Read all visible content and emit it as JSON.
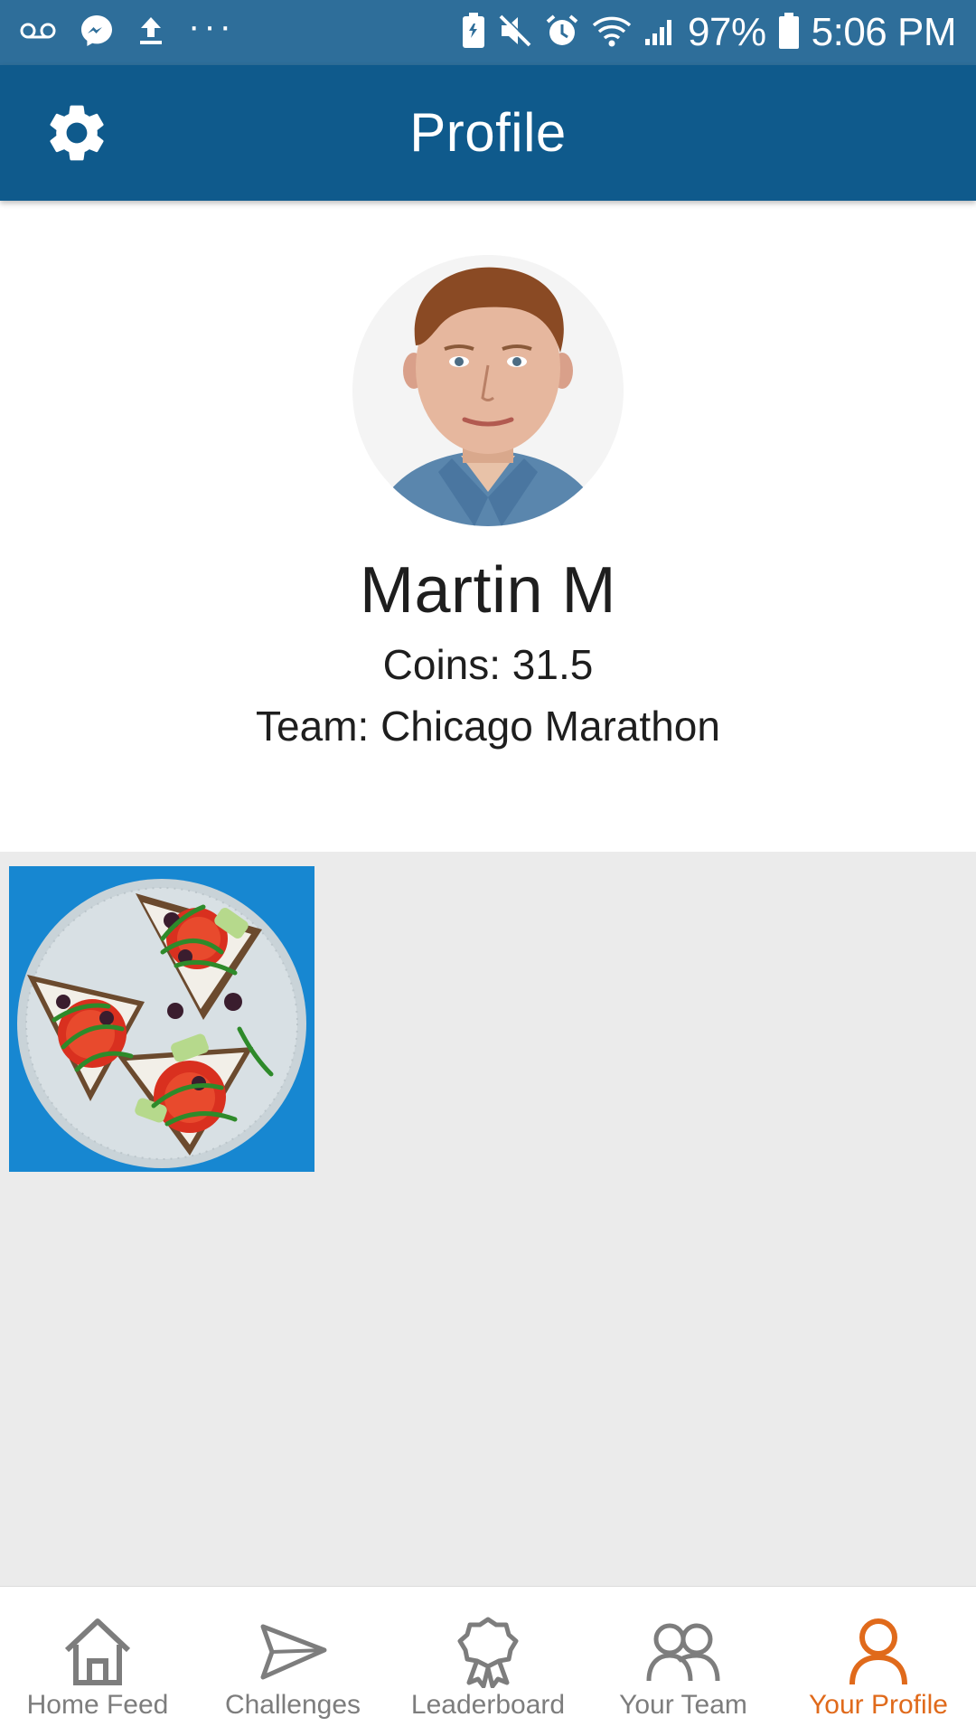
{
  "status_bar": {
    "battery": "97%",
    "time": "5:06 PM"
  },
  "app_bar": {
    "title": "Profile",
    "settings_icon": "gear-icon"
  },
  "profile": {
    "name": "Martin M",
    "coins": "Coins: 31.5",
    "team": "Team: Chicago Marathon"
  },
  "posts": [
    {
      "subject": "food-photo"
    }
  ],
  "bottom_nav": {
    "active": "Your Profile",
    "active_color": "#e06a1b",
    "inactive_color": "#7d7d7d",
    "items": [
      {
        "label": "Home Feed",
        "icon": "home-icon"
      },
      {
        "label": "Challenges",
        "icon": "paper-plane-icon"
      },
      {
        "label": "Leaderboard",
        "icon": "ribbon-icon"
      },
      {
        "label": "Your Team",
        "icon": "team-icon"
      },
      {
        "label": "Your Profile",
        "icon": "person-icon"
      }
    ]
  },
  "colors": {
    "status_bar": "#2e6e9a",
    "app_bar": "#0f5a8c",
    "posts_background": "#ebebeb"
  }
}
